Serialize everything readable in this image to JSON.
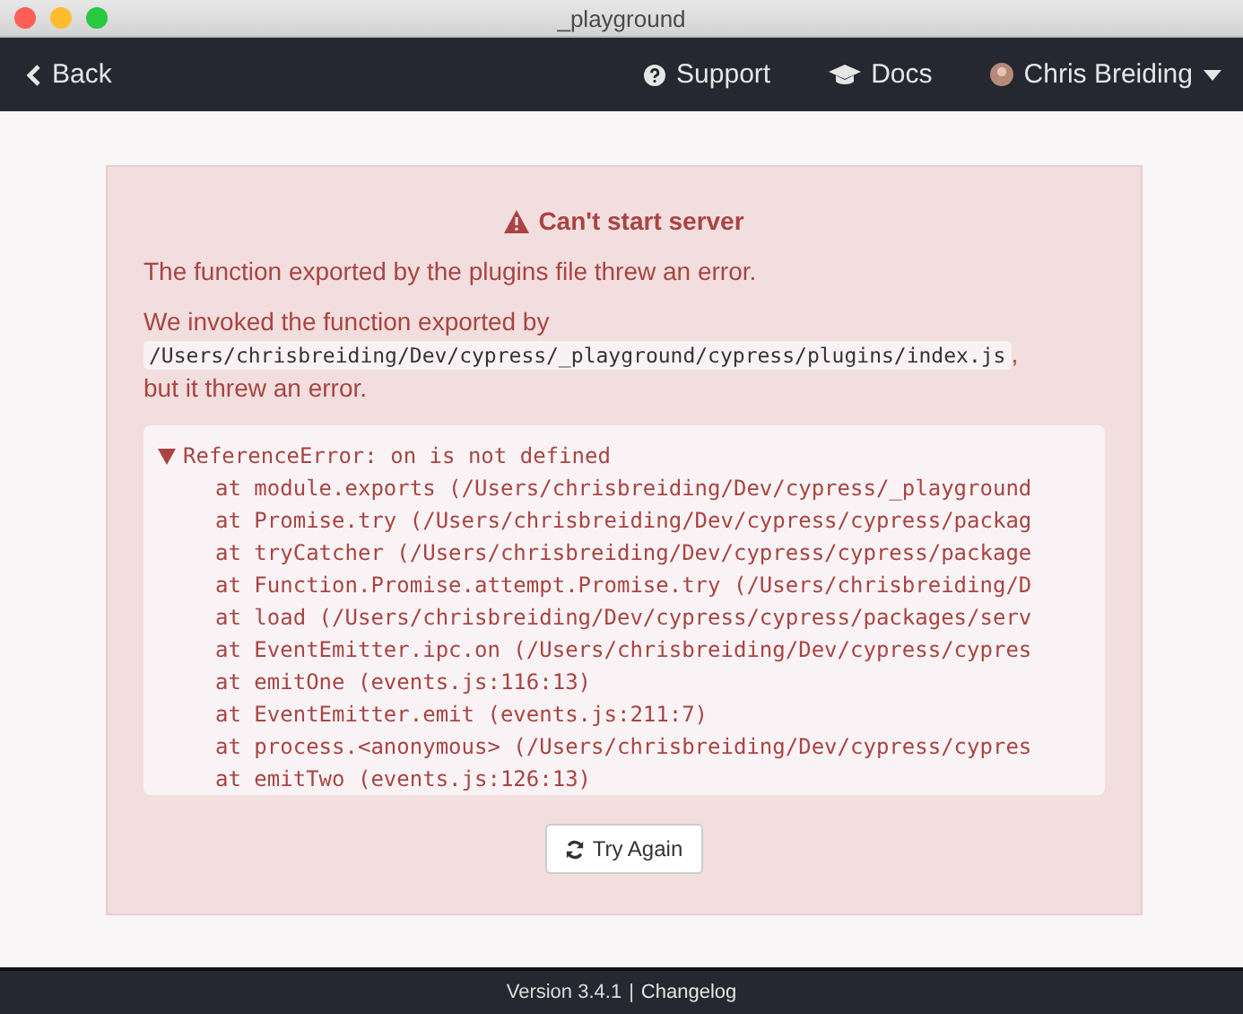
{
  "window": {
    "title": "_playground"
  },
  "nav": {
    "back": "Back",
    "links": [
      {
        "kind": "help",
        "label": "Support"
      },
      {
        "kind": "docs",
        "label": "Docs"
      }
    ],
    "user": "Chris Breiding"
  },
  "alert": {
    "title": "Can't start server",
    "message": "The function exported by the plugins file threw an error.",
    "detail_before": "We invoked the function exported by",
    "path": "/Users/chrisbreiding/Dev/cypress/_playground/cypress/plugins/index.js",
    "path_suffix": ",",
    "detail_after": "but it threw an error.",
    "stack": {
      "expanded": true,
      "error": "ReferenceError: on is not defined",
      "lines": [
        "at module.exports (/Users/chrisbreiding/Dev/cypress/_playground",
        "at Promise.try (/Users/chrisbreiding/Dev/cypress/cypress/packag",
        "at tryCatcher (/Users/chrisbreiding/Dev/cypress/cypress/package",
        "at Function.Promise.attempt.Promise.try (/Users/chrisbreiding/D",
        "at load (/Users/chrisbreiding/Dev/cypress/cypress/packages/serv",
        "at EventEmitter.ipc.on (/Users/chrisbreiding/Dev/cypress/cypres",
        "at emitOne (events.js:116:13)",
        "at EventEmitter.emit (events.js:211:7)",
        "at process.<anonymous> (/Users/chrisbreiding/Dev/cypress/cypres",
        "at emitTwo (events.js:126:13)"
      ]
    },
    "button": "Try Again"
  },
  "footer": {
    "version": "Version 3.4.1",
    "separator": "|",
    "link": "Changelog"
  }
}
